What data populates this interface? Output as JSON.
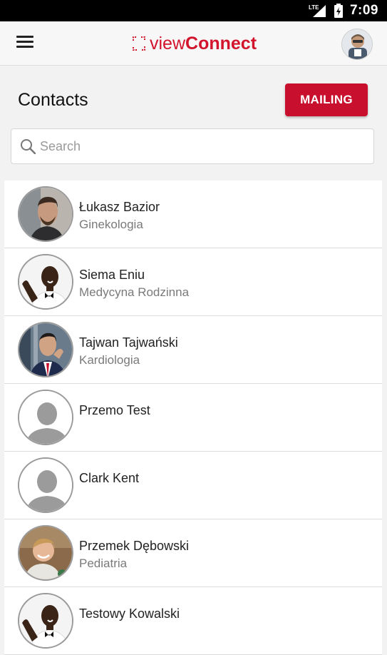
{
  "status_bar": {
    "network": "LTE",
    "time": "7:09"
  },
  "app_bar": {
    "logo_light": "view",
    "logo_bold": "Connect"
  },
  "page": {
    "title": "Contacts",
    "mailing_label": "MAILING",
    "search_placeholder": "Search"
  },
  "colors": {
    "accent": "#c8102e",
    "background": "#f2f2f2"
  },
  "contacts": [
    {
      "name": "Łukasz Bazior",
      "specialty": "Ginekologia",
      "avatar": "photo"
    },
    {
      "name": "Siema Eniu",
      "specialty": "Medycyna Rodzinna",
      "avatar": "photo"
    },
    {
      "name": "Tajwan Tajwański",
      "specialty": "Kardiologia",
      "avatar": "photo"
    },
    {
      "name": "Przemo Test",
      "specialty": "",
      "avatar": "default-user-icon"
    },
    {
      "name": "Clark Kent",
      "specialty": "",
      "avatar": "default-user-icon"
    },
    {
      "name": "Przemek Dębowski",
      "specialty": "Pediatria",
      "avatar": "photo"
    },
    {
      "name": "Testowy Kowalski",
      "specialty": "",
      "avatar": "photo"
    }
  ]
}
